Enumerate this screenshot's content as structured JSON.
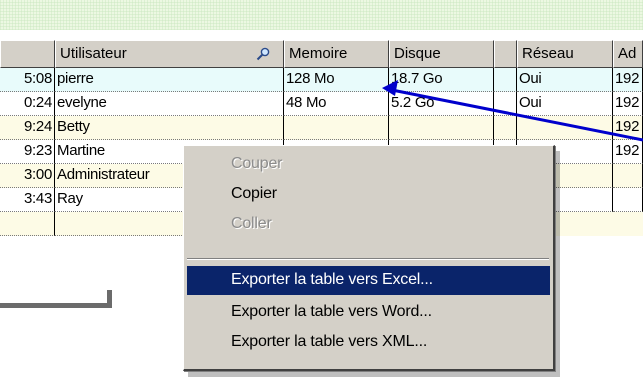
{
  "table": {
    "headers": [
      "",
      "Utilisateur",
      "Memoire",
      "Disque",
      "",
      "Réseau",
      "Ad"
    ],
    "rows": [
      {
        "time": "5:08",
        "user": "pierre",
        "memory": "128 Mo",
        "disk": "18.7  Go",
        "network": "Oui",
        "addr": "192"
      },
      {
        "time": "0:24",
        "user": "evelyne",
        "memory": "48 Mo",
        "disk": "5.2  Go",
        "network": "Oui",
        "addr": "192"
      },
      {
        "time": "9:24",
        "user": "Betty",
        "memory": "",
        "disk": "",
        "network": "",
        "addr": "192"
      },
      {
        "time": "9:23",
        "user": "Martine",
        "memory": "",
        "disk": "",
        "network": "",
        "addr": "192"
      },
      {
        "time": "3:00",
        "user": "Administrateur",
        "memory": "",
        "disk": "",
        "network": "",
        "addr": ""
      },
      {
        "time": "3:43",
        "user": "Ray",
        "memory": "",
        "disk": "",
        "network": "",
        "addr": ""
      },
      {
        "time": "",
        "user": "",
        "memory": "",
        "disk": "",
        "network": "",
        "addr": ""
      }
    ],
    "row_colors": [
      "#e8fbfb",
      "#ffffff",
      "#fdfbe6",
      "#ffffff",
      "#fdfbe6",
      "#ffffff",
      "#fdfbe6"
    ]
  },
  "context_menu": {
    "items": [
      {
        "label": "Couper",
        "enabled": false
      },
      {
        "label": "Copier",
        "enabled": true
      },
      {
        "label": "Coller",
        "enabled": false
      },
      {
        "label": "Exporter la table vers Excel...",
        "enabled": true,
        "highlighted": true
      },
      {
        "label": "Exporter la table vers Word...",
        "enabled": true
      },
      {
        "label": "Exporter la table vers XML...",
        "enabled": true
      }
    ]
  },
  "colors": {
    "highlight": "#0a246a",
    "annotation_arrow": "#0000cc",
    "menu_bg": "#d4d0c8"
  },
  "icons": {
    "header_search": "magnifier-icon"
  }
}
